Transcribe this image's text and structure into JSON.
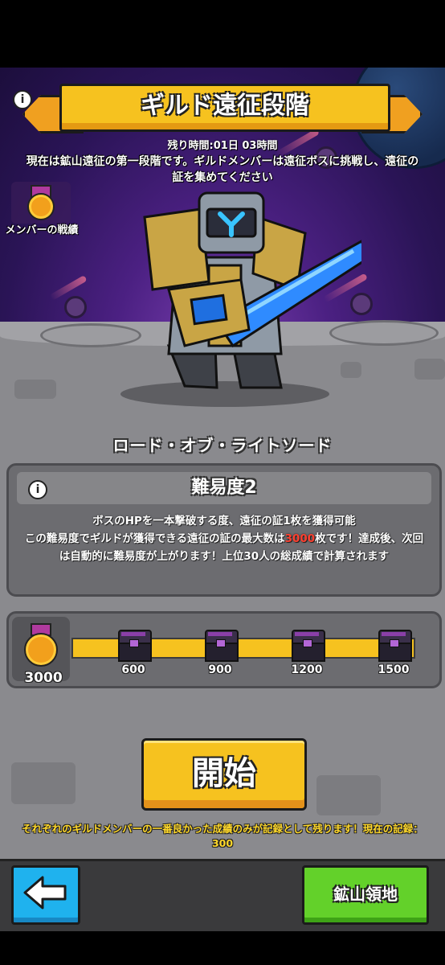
{
  "header": {
    "title": "ギルド遠征段階",
    "remaining_time": "残り時間:01日 03時間",
    "description": "現在は鉱山遠征の第一段階です。ギルドメンバーは遠征ボスに挑戦し、遠征の証を集めてください"
  },
  "member_record": {
    "label": "メンバーの戦績"
  },
  "boss": {
    "name": "ロード・オブ・ライトソード"
  },
  "difficulty": {
    "title": "難易度2",
    "line1": "ボスのHPを一本撃破する度、遠征の証1枚を獲得可能",
    "line2_pre": "この難易度でギルドが獲得できる遠征の証の最大数は",
    "line2_highlight": "3000",
    "line2_post": "枚です！達成後、次回は自動的に難易度が上がります！上位30人の総成績で計算されます"
  },
  "progress": {
    "current": "3000",
    "fill_fraction": 1.0,
    "milestones": [
      "600",
      "900",
      "1200",
      "1500"
    ]
  },
  "actions": {
    "start_label": "開始",
    "note": "それぞれのギルドメンバーの一番良かった成績のみが記録として残ります！現在の記録：300",
    "mine_label": "鉱山領地"
  },
  "colors": {
    "banner": "#f6c21f",
    "highlight_red": "#ff4030",
    "start_button": "#f6c21f",
    "back_button": "#1fb2ee",
    "mine_button": "#63d12a"
  }
}
